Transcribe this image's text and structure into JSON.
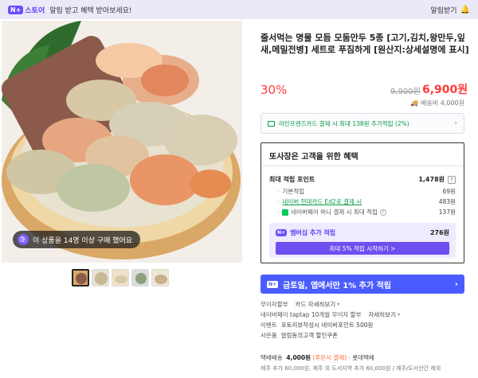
{
  "topbar": {
    "badge": "N+",
    "store": "스토어",
    "message": "알림 받고 혜택 받아보세요!",
    "right_label": "알림받기",
    "right_icon": "bell-icon"
  },
  "product": {
    "buyers_pill": "이 상품을 14명 이상 구매 했어요",
    "title": "줄서먹는 명물 모듬 모둠만두 5종 [고기,김치,왕만두,잎새,메밀전병] 세트로 푸짐하게 [원산지:상세설명에 표시]",
    "discount": "30%",
    "original_price": "9,900원",
    "sale_price": "6,900원",
    "shipping_summary": "배송비 4,000원"
  },
  "card_benefit": {
    "text": "라인프렌즈카드 결제 시 최대 138원 추가적립 (2%)"
  },
  "benefit_box": {
    "title": "또사장은 고객을 위한 혜택",
    "max_points_label": "최대 적립 포인트",
    "max_points_value": "1,478원",
    "help_icon": "?",
    "rows": [
      {
        "label": "기본적립",
        "value": "69원"
      },
      {
        "label": "네이버 현대카드 Ed2로 결제 시",
        "value": "483원"
      },
      {
        "label": "네이버페이 머니 결제 시 최대 적립",
        "value": "137원"
      }
    ],
    "membership_label": "멤버십 추가 적립",
    "membership_value": "276원",
    "membership_button": "최대 5% 적립 시작하기 >"
  },
  "promo": {
    "badge": "N+",
    "text": "금토일, 앱에서만 1% 추가 적립"
  },
  "info": [
    {
      "key": "무이자할부",
      "value": "카드 자세히보기",
      "dropdown": true
    },
    {
      "key": "네이버페이 taptap 10개월 무이자 할부",
      "value": "자세히보기",
      "dropdown": true
    },
    {
      "key": "이벤트",
      "value": "포토리뷰작성시 네이버포인트 500원"
    },
    {
      "key": "사은품",
      "value": "알림동의고객 할인쿠폰"
    }
  ],
  "shipping": {
    "label": "택배배송",
    "price": "4,000원",
    "condition": "(주문시 결제)",
    "carrier": "· 롯데택배",
    "extra": "제주 추가 60,000원, 제주 외 도서지역 추가 60,000원 / 제주/도서산간 제외"
  }
}
